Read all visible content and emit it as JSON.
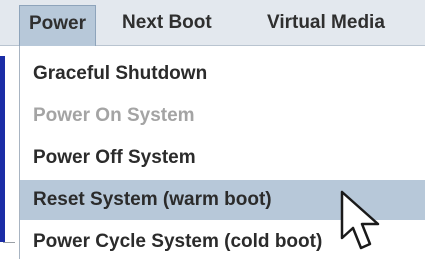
{
  "menubar": {
    "items": [
      {
        "label": "Power",
        "state": "open"
      },
      {
        "label": "Next Boot"
      },
      {
        "label": "Virtual Media"
      }
    ]
  },
  "power_menu": {
    "items": [
      {
        "label": "Graceful Shutdown",
        "enabled": true
      },
      {
        "label": "Power On System",
        "enabled": false
      },
      {
        "label": "Power Off System",
        "enabled": true
      },
      {
        "label": "Reset System (warm boot)",
        "enabled": true,
        "highlighted": true
      },
      {
        "label": "Power Cycle System (cold boot)",
        "enabled": true
      }
    ]
  },
  "colors": {
    "menubar_bg": "#e3e8ee",
    "highlight_bg": "#b7c8d9",
    "text": "#2b2b2b",
    "disabled_text": "#a4a4a4",
    "accent_blue": "#1b2da6"
  },
  "icons": {
    "cursor": "mouse-pointer-icon"
  }
}
